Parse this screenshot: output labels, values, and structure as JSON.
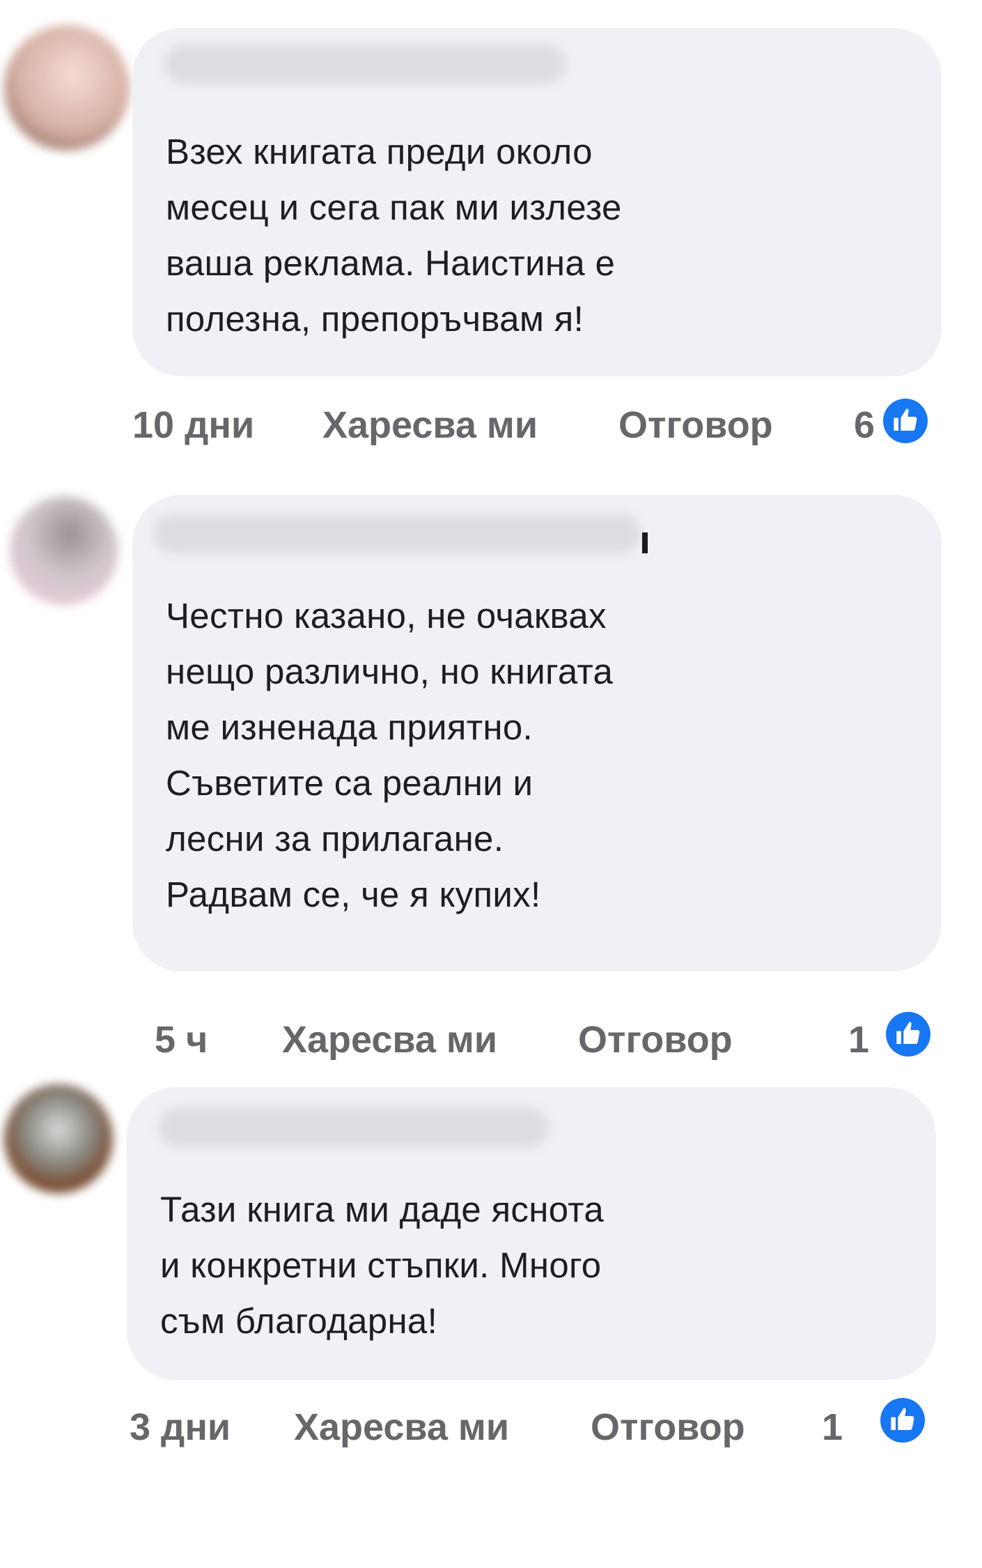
{
  "comments": [
    {
      "text_lines": [
        "Взех книгата преди около",
        "месец и сега пак ми излезе",
        "ваша реклама. Наистина е",
        "полезна, препоръчвам я!"
      ],
      "time": "10 дни",
      "like_label": "Харесва ми",
      "reply_label": "Отговор",
      "reaction_count": "6"
    },
    {
      "text_lines": [
        "Честно казано, не очаквах",
        "нещо различно, но книгата",
        "ме изненада приятно.",
        "Съветите са реални и",
        "лесни за прилагане.",
        "Радвам се, че я купих!"
      ],
      "time": "5 ч",
      "like_label": "Харесва ми",
      "reply_label": "Отговор",
      "reaction_count": "1"
    },
    {
      "text_lines": [
        "Тази книга ми даде яснота",
        "и конкретни стъпки. Много",
        "съм благодарна!"
      ],
      "time": "3 дни",
      "like_label": "Харесва ми",
      "reply_label": "Отговор",
      "reaction_count": "1"
    }
  ],
  "colors": {
    "bubble": "#f0f1f5",
    "meta_text": "#65676b",
    "like_blue": "#1877f2"
  }
}
